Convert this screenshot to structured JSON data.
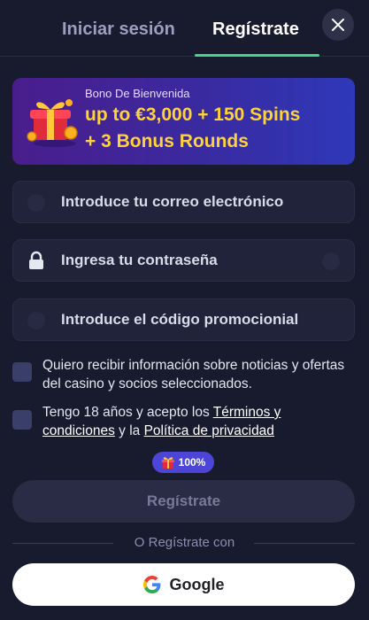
{
  "tabs": {
    "login": "Iniciar sesión",
    "register": "Regístrate"
  },
  "close_icon": "close-icon",
  "banner": {
    "subtitle": "Bono De Bienvenida",
    "line1": "up to €3,000 + 150 Spins",
    "line2": "+ 3 Bonus Rounds",
    "icon": "gift-icon"
  },
  "form": {
    "email_placeholder": "Introduce tu correo electrónico",
    "password_placeholder": "Ingresa tu contraseña",
    "promo_placeholder": "Introduce el código promocionial"
  },
  "consents": {
    "marketing_text": "Quiero recibir información sobre noticias y ofertas del casino y socios seleccionados.",
    "age_prefix": "Tengo 18 años y acepto los ",
    "terms_link": "Términos y condiciones",
    "age_mid": " y la ",
    "privacy_link": "Política de privacidad"
  },
  "progress_badge": {
    "value": "100%",
    "icon": "gift-icon"
  },
  "submit_label": "Regístrate",
  "divider_text": "O Regístrate con",
  "google": {
    "label": "Google",
    "icon": "google-icon"
  },
  "colors": {
    "background": "#181a2e",
    "accent_green": "#45d48a",
    "banner_yellow": "#ffd23a",
    "badge_purple": "#4d45d6"
  }
}
